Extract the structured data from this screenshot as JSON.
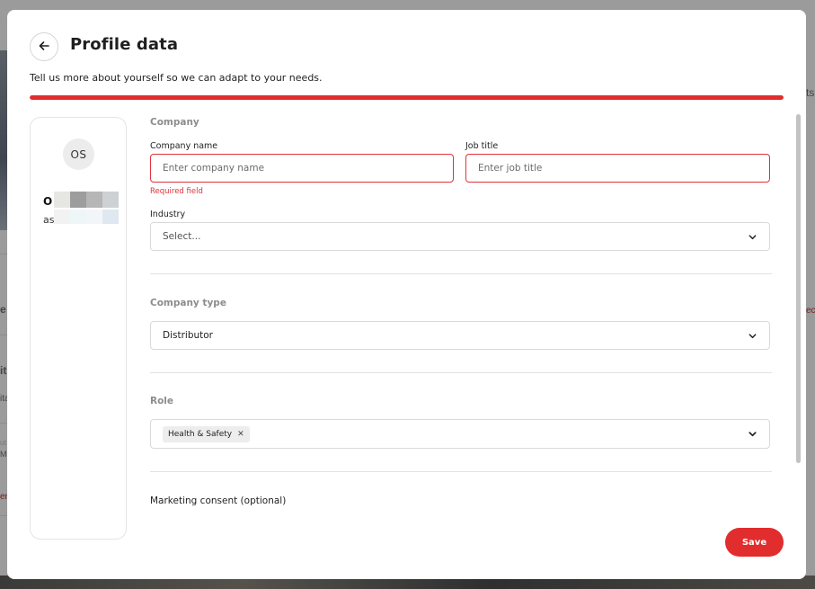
{
  "header": {
    "title": "Profile data",
    "subtitle": "Tell us more about yourself so we can adapt to your needs.",
    "progress_fraction": 1.0
  },
  "user_card": {
    "initials": "OS",
    "name_prefix": "O",
    "sub_prefix": "as"
  },
  "company": {
    "section_title": "Company",
    "company_name": {
      "label": "Company name",
      "placeholder": "Enter company name",
      "value": "",
      "error": "Required field"
    },
    "job_title": {
      "label": "Job title",
      "placeholder": "Enter job title",
      "value": ""
    },
    "industry": {
      "label": "Industry",
      "selected": "Select..."
    }
  },
  "company_type": {
    "section_title": "Company type",
    "selected": "Distributor"
  },
  "role": {
    "section_title": "Role",
    "chips": [
      "Health & Safety"
    ]
  },
  "marketing": {
    "label": "Marketing consent (optional)"
  },
  "footer": {
    "save_label": "Save"
  },
  "colors": {
    "accent": "#e12d2d",
    "error": "#e0323a",
    "section_title": "#8c8c8c"
  },
  "icons": {
    "back": "arrow-left-icon",
    "dropdown": "chevron-down-icon",
    "chip_remove": "close-icon"
  },
  "background_page": {
    "edge_texts": [
      "ts",
      "e",
      "ec",
      "it",
      "ita",
      "ut",
      "Ma",
      "en"
    ]
  }
}
